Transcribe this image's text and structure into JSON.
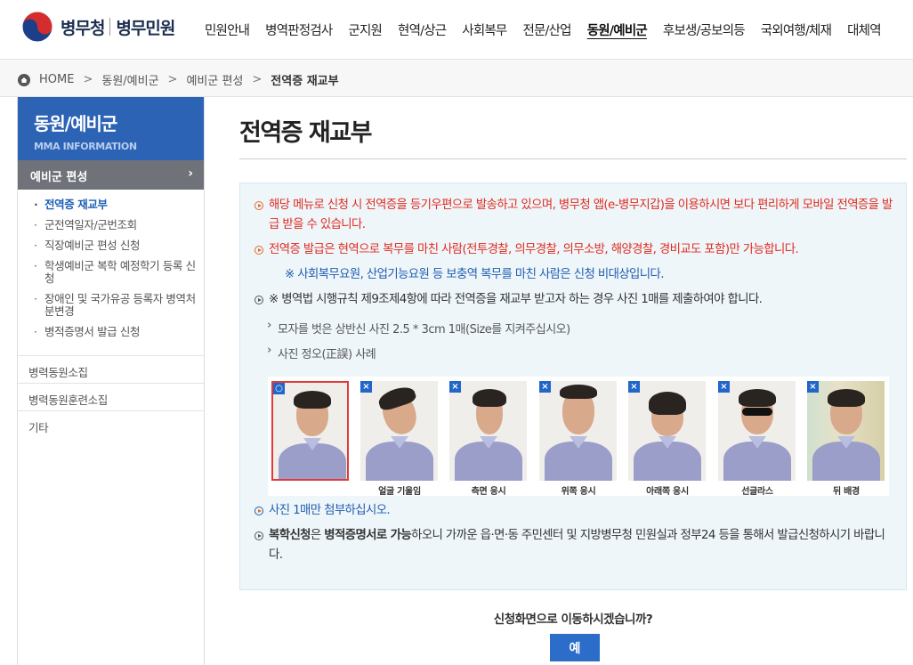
{
  "header": {
    "logo_text": "병무청",
    "logo_sub": "병무민원",
    "nav": [
      "민원안내",
      "병역판정검사",
      "군지원",
      "현역/상근",
      "사회복무",
      "전문/산업",
      "동원/예비군",
      "후보생/공보의등",
      "국외여행/체재",
      "대체역"
    ],
    "nav_active_index": 6
  },
  "breadcrumb": {
    "items": [
      "HOME",
      "동원/예비군",
      "예비군 편성",
      "전역증 재교부"
    ],
    "separator": ">"
  },
  "sidebar": {
    "title": "동원/예비군",
    "subtitle": "MMA INFORMATION",
    "section": "예비군 편성",
    "section_arrow": "›",
    "sub_items": [
      "전역증 재교부",
      "군전역일자/군번조회",
      "직장예비군 편성 신청",
      "학생예비군 복학 예정학기 등록 신청",
      "장애인 및 국가유공 등록자 병역처분변경",
      "병적증명서 발급 신청"
    ],
    "sub_active_index": 0,
    "menu_items": [
      "병력동원소집",
      "병력동원훈련소집",
      "기타"
    ]
  },
  "main": {
    "title": "전역증 재교부",
    "notice_1": "해당 메뉴로 신청 시 전역증을 등기우편으로 발송하고 있으며, 병무청 앱(e-병무지갑)을 이용하시면 보다 편리하게 모바일 전역증을 발급 받을 수 있습니다.",
    "notice_2": "전역증 발급은 현역으로 복무를 마친 사람(전투경찰, 의무경찰, 의무소방, 해양경찰, 경비교도 포함)만 가능합니다.",
    "notice_2_note": "※ 사회복무요원, 산업기능요원 등 보충역 복무를 마친 사람은 신청 비대상입니다.",
    "notice_3": "※ 병역법 시행규칙 제9조제4항에 따라 전역증을 재교부 받고자 하는 경우 사진 1매를 제출하여야 합니다.",
    "sub_1": "모자를 벗은 상반신 사진 2.5 * 3cm 1매(Size를 지켜주십시오)",
    "sub_2": "사진 정오(正誤) 사례",
    "photos": [
      {
        "badge": "○",
        "caption": ""
      },
      {
        "badge": "×",
        "caption": "얼굴 기울임"
      },
      {
        "badge": "×",
        "caption": "측면 응시"
      },
      {
        "badge": "×",
        "caption": "위쪽 응시"
      },
      {
        "badge": "×",
        "caption": "아래쪽 응시"
      },
      {
        "badge": "×",
        "caption": "선글라스"
      },
      {
        "badge": "×",
        "caption": "뒤 배경"
      }
    ],
    "notice_4": "사진 1매만 첨부하십시오.",
    "notice_5_bold_1": "복학신청",
    "notice_5_text_1": "은 ",
    "notice_5_bold_2": "병적증명서로 가능",
    "notice_5_text_2": "하오니 가까운 읍·면·동 주민센터 및 지방병무청 민원실과 정부24 등을 통해서 발급신청하시기 바랍니다.",
    "confirm_question": "신청화면으로 이동하시겠습니까?",
    "yes_label": "예"
  },
  "colors": {
    "brand_blue": "#2c63b5",
    "notice_red": "#e02b1f",
    "link_blue": "#1f5cb0",
    "button_blue": "#2c6dc9",
    "info_bg": "#eef6fa"
  },
  "icons": {
    "home": "home-icon",
    "bullet": "circle-arrow-bullet-icon",
    "ok_badge": "circle-ok-icon",
    "ng_badge": "x-mark-icon"
  }
}
